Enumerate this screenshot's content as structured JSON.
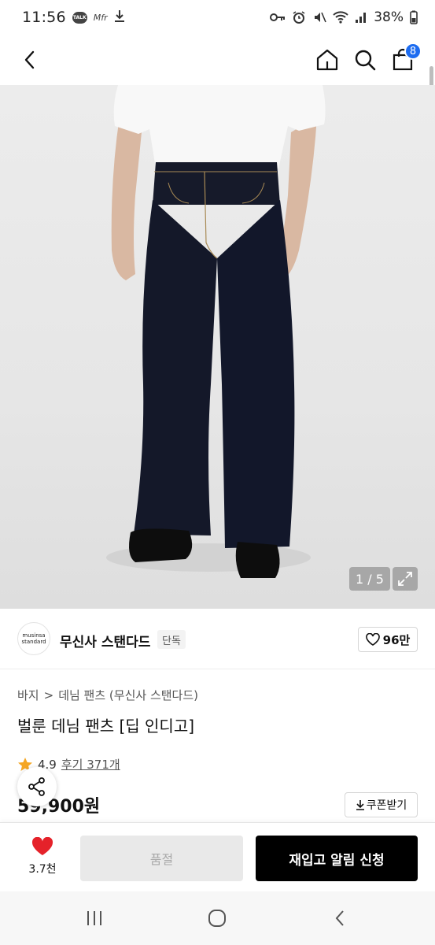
{
  "status_bar": {
    "time": "11:56",
    "notif_talk": "TALK",
    "notif_app": "Mfr",
    "battery": "38%"
  },
  "cart": {
    "badge_count": "8"
  },
  "gallery": {
    "counter": "1 / 5"
  },
  "brand": {
    "logo_text_line1": "musinsa",
    "logo_text_line2": "standard",
    "name": "무신사 스탠다드",
    "badge": "단독"
  },
  "like": {
    "count": "96만"
  },
  "breadcrumb": {
    "level1": "바지",
    "separator": ">",
    "level2": "데님 팬츠 (무신사 스탠다드)"
  },
  "product": {
    "title": "벌룬 데님 팬츠 [딥 인디고]",
    "rating": "4.9",
    "reviews": "후기 371개",
    "price": "59,900원"
  },
  "coupon": {
    "label": "쿠폰받기"
  },
  "bottom_bar": {
    "wish_count": "3.7천",
    "soldout_label": "품절",
    "restock_label": "재입고 알림 신청"
  },
  "colors": {
    "accent_blue": "#1d6cf0",
    "heart_red": "#e5222a",
    "star_orange": "#f5a623",
    "denim": "#151a2b"
  }
}
